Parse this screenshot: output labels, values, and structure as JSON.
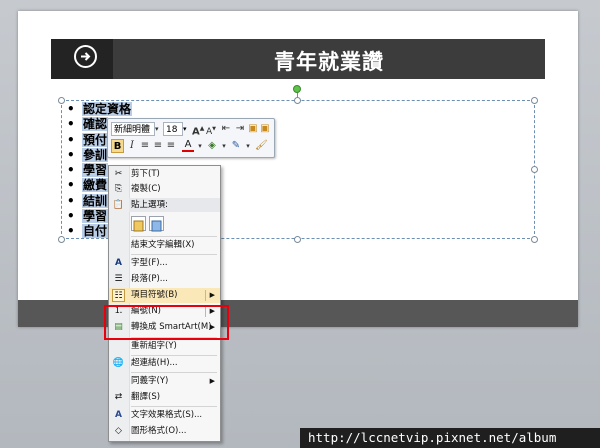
{
  "slide": {
    "title": "青年就業讚",
    "bullets": [
      "認定資格",
      "確認",
      "預付",
      "參訓",
      "學習",
      "繳費",
      "結訓",
      "學習",
      "自付"
    ]
  },
  "minibar": {
    "font_name": "新細明體",
    "font_size": "18",
    "bold_label": "B",
    "italic_label": "I",
    "font_color_label": "A"
  },
  "context_menu": {
    "cut": "剪下(T)",
    "copy": "複製(C)",
    "paste_options": "貼上選項:",
    "exit_text_edit": "結束文字編輯(X)",
    "font": "字型(F)...",
    "paragraph": "段落(P)...",
    "bullets": "項目符號(B)",
    "numbering": "編號(N)",
    "convert_smartart": "轉換成 SmartArt(M)",
    "reuse_text": "重新組字(Y)",
    "hyperlink": "超連結(H)...",
    "synonyms": "同義字(Y)",
    "translate": "翻譯(S)",
    "text_effects": "文字效果格式(S)...",
    "shape_format": "圖形格式(O)..."
  },
  "colors": {
    "title_bar": "#3c3c3c",
    "footer_bar": "#575757",
    "selection_highlight": "#b9cde6",
    "highlight_box": "#e8000c"
  },
  "watermark": {
    "url": "http://lccnetvip.pixnet.net/album"
  }
}
